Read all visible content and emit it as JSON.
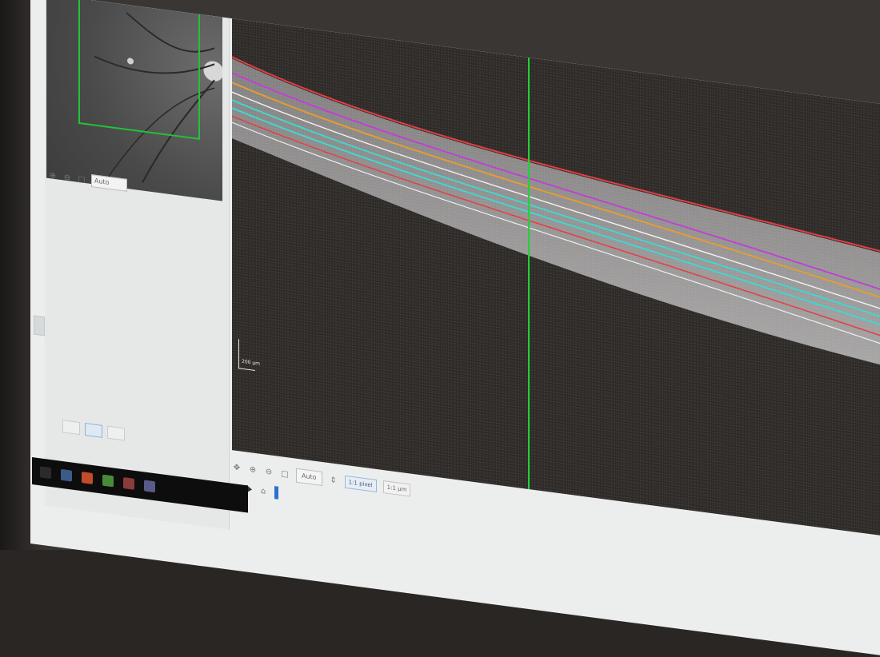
{
  "viewer": {
    "scale_label": "200 µm"
  },
  "fundus": {
    "toolbar_icons": [
      "zoom-in-icon",
      "zoom-out-icon",
      "fit-icon"
    ],
    "zoom_select": "Auto"
  },
  "bottom_toolbar": {
    "zoom_select": "Auto",
    "pixel_label": "1:1 pixel",
    "um_label": "1:1 µm"
  },
  "colors": {
    "accent_green": "#1fd13a",
    "layer_red": "#e4393f",
    "layer_magenta": "#c03ad6",
    "layer_orange": "#e69a2a",
    "layer_cyan": "#39d7d0",
    "layer_white": "#f0f0f0"
  }
}
